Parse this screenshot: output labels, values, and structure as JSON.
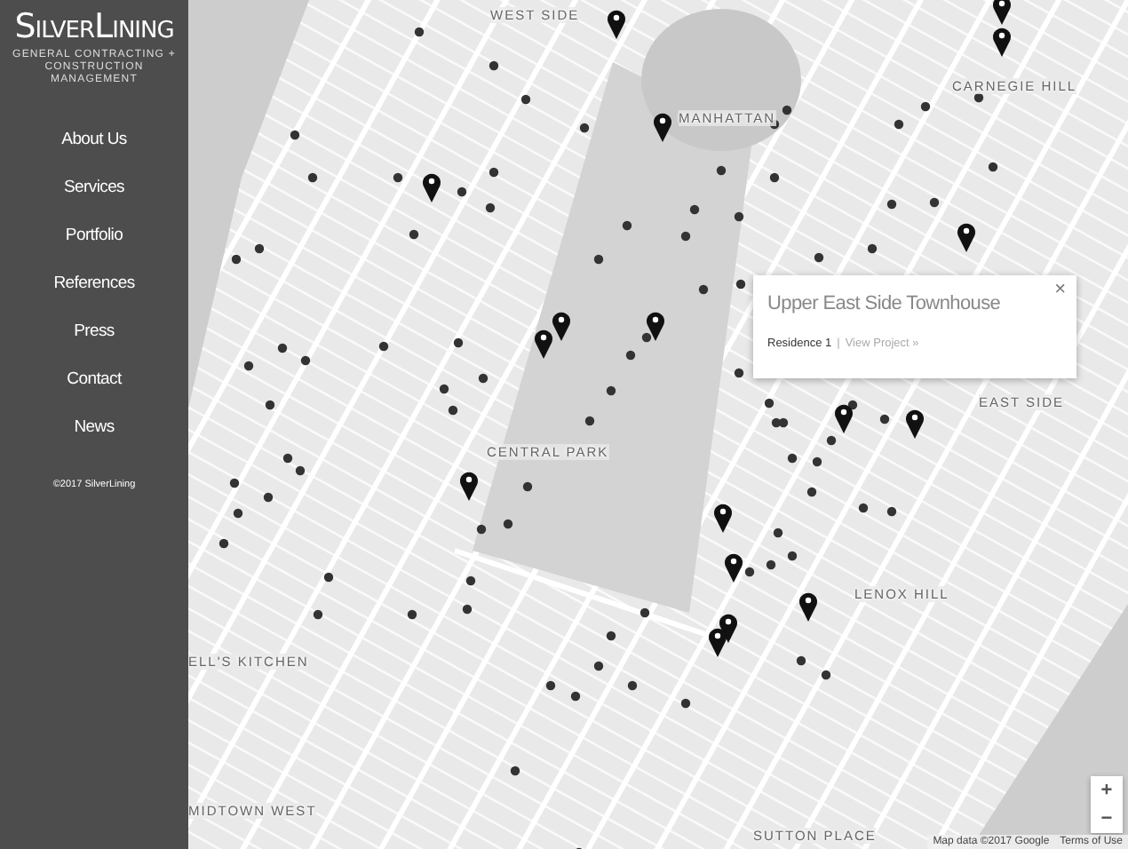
{
  "sidebar": {
    "logo": "SilverLining",
    "tagline": "GENERAL CONTRACTING + CONSTRUCTION MANAGEMENT",
    "nav": [
      {
        "label": "About Us",
        "selected": false
      },
      {
        "label": "Services",
        "selected": false
      },
      {
        "label": "Portfolio",
        "selected": false
      },
      {
        "label": "References",
        "selected": false
      },
      {
        "label": "Press",
        "selected": false
      },
      {
        "label": "Contact",
        "selected": false
      },
      {
        "label": "News",
        "selected": false
      }
    ],
    "copyright": "©2017 SilverLining"
  },
  "map": {
    "labels": [
      "WEST SIDE",
      "MANHATTAN",
      "CARNEGIE HILL",
      "CENTRAL PARK",
      "EAST SIDE",
      "LENOX HILL",
      "ELL'S KITCHEN",
      "MIDTOWN WEST",
      "SUTTON PLACE"
    ],
    "popup": {
      "title": "Upper East Side Townhouse",
      "category": "Residence 1",
      "separator": "|",
      "link": "View Project »",
      "close": "×"
    },
    "zoom": {
      "in": "+",
      "out": "−"
    },
    "attribution": "Map data ©2017 Google",
    "terms": "Terms of Use"
  }
}
